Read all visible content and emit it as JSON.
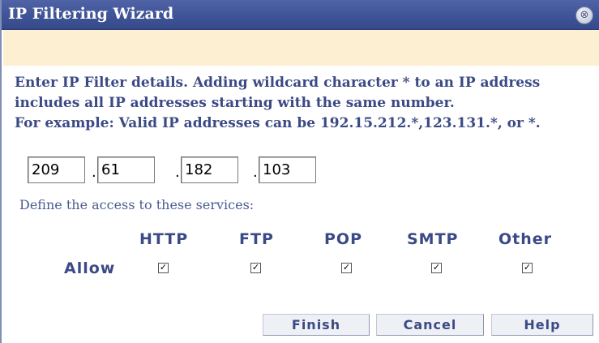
{
  "window": {
    "title": "IP Filtering Wizard",
    "close_glyph": "⊗"
  },
  "instructions": {
    "line1": "Enter IP Filter details. Adding wildcard character * to an IP address",
    "line2": "includes all IP addresses starting with the same number.",
    "line3": "For example: Valid IP addresses can be 192.15.212.*,123.131.*, or *."
  },
  "ip_address": {
    "octets": [
      "209",
      "61",
      "182",
      "103"
    ],
    "separator": "."
  },
  "services": {
    "define_label": "Define the access to these services:",
    "allow_label": "Allow",
    "columns": [
      {
        "label": "HTTP",
        "allowed": true
      },
      {
        "label": "FTP",
        "allowed": true
      },
      {
        "label": "POP",
        "allowed": true
      },
      {
        "label": "SMTP",
        "allowed": true
      },
      {
        "label": "Other",
        "allowed": true
      }
    ]
  },
  "buttons": {
    "finish": "Finish",
    "cancel": "Cancel",
    "help": "Help"
  },
  "icons": {
    "close": "close-icon",
    "checkmark": "checkmark-icon"
  },
  "colors": {
    "titlebar": "#3f5496",
    "banner": "#fdf0d2",
    "text_accent": "#3b4a85"
  }
}
